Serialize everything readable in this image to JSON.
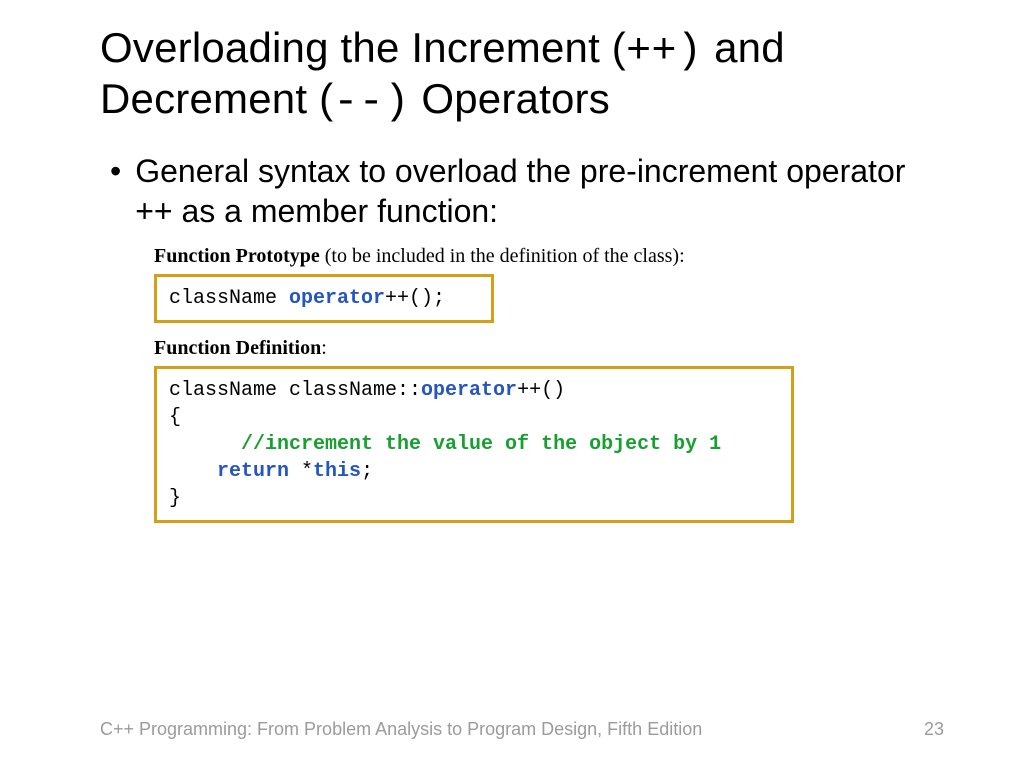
{
  "title": {
    "part1": "Overloading the Increment (",
    "mono1": "++)",
    "part2": " and Decrement (",
    "mono2": "--)",
    "part3": "  Operators"
  },
  "bullet1": "General syntax to overload the pre-increment operator ++ as a member function:",
  "proto": {
    "label_bold": "Function Prototype",
    "label_rest": " (to be included in the definition of the class):",
    "code_plain1": "className ",
    "code_kw": "operator",
    "code_plain2": "++();"
  },
  "def": {
    "label_bold": "Function Definition",
    "label_rest": ":",
    "line1a": "className className::",
    "line1kw": "operator",
    "line1b": "++()",
    "line2": "{",
    "line3_indent": "      ",
    "line3_cm": "//increment the value of the object by 1",
    "line4_indent": "    ",
    "line4_kw": "return",
    "line4_rest": " *",
    "line4_kw2": "this",
    "line4_semi": ";",
    "line5": "}"
  },
  "footer": {
    "left": "C++ Programming: From Problem Analysis to Program Design, Fifth Edition",
    "right": "23"
  }
}
